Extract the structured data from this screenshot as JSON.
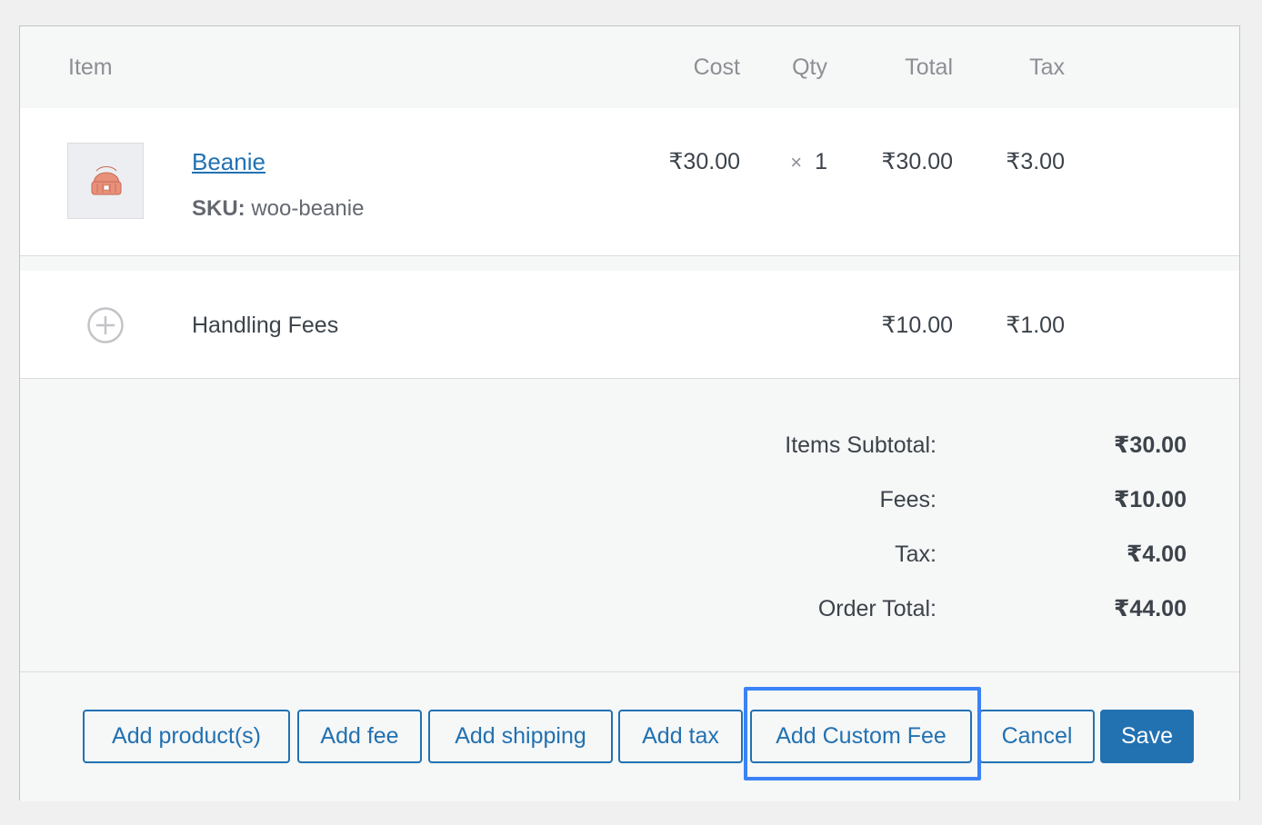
{
  "table": {
    "headers": {
      "item": "Item",
      "cost": "Cost",
      "qty": "Qty",
      "total": "Total",
      "tax": "Tax"
    }
  },
  "product": {
    "name": "Beanie",
    "sku_label": "SKU:",
    "sku_value": "woo-beanie",
    "cost": "₹30.00",
    "qty_prefix": "×",
    "qty": "1",
    "total": "₹30.00",
    "tax": "₹3.00",
    "thumbnail_icon": "beanie-hat-icon"
  },
  "fee": {
    "name": "Handling Fees",
    "total": "₹10.00",
    "tax": "₹1.00",
    "icon": "plus-circle-icon"
  },
  "totals": {
    "items_subtotal_label": "Items Subtotal:",
    "items_subtotal_value": "₹30.00",
    "fees_label": "Fees:",
    "fees_value": "₹10.00",
    "tax_label": "Tax:",
    "tax_value": "₹4.00",
    "order_total_label": "Order Total:",
    "order_total_value": "₹44.00"
  },
  "actions": {
    "add_products": "Add product(s)",
    "add_fee": "Add fee",
    "add_shipping": "Add shipping",
    "add_tax": "Add tax",
    "add_custom_fee": "Add Custom Fee",
    "cancel": "Cancel",
    "save": "Save"
  },
  "colors": {
    "accent": "#2271b1",
    "highlight": "#3b82f6",
    "panel_bg": "#f6f7f7",
    "row_bg": "#ffffff"
  }
}
